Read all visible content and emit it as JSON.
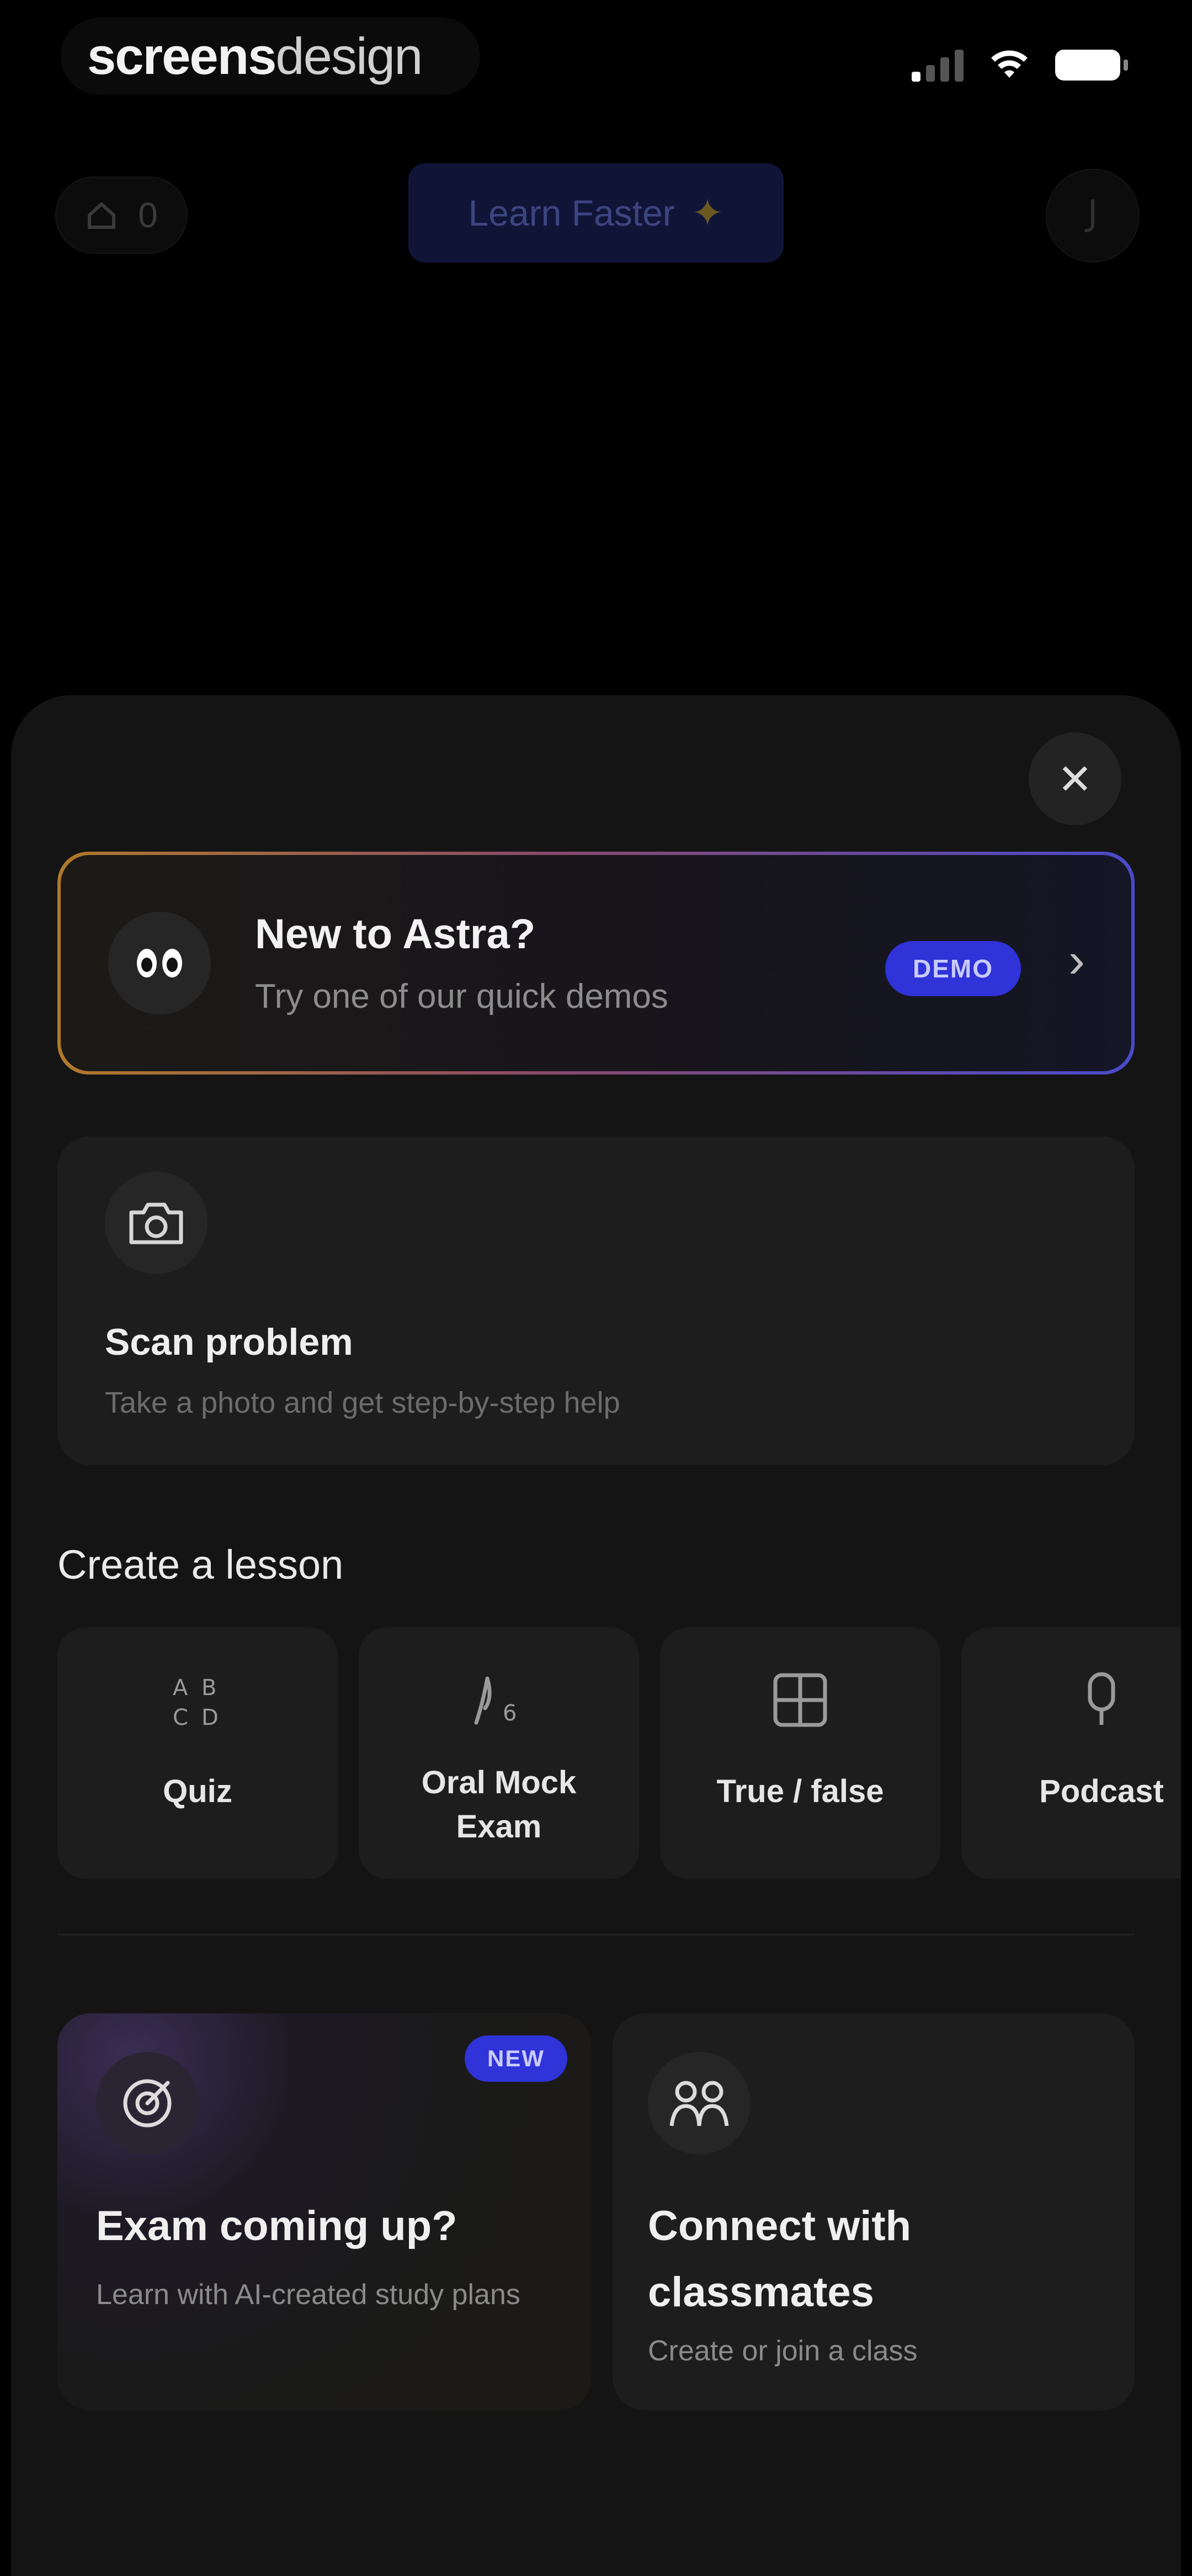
{
  "status_bar": {
    "brand_bold": "screens",
    "brand_light": "design"
  },
  "background": {
    "streak_count": "0",
    "learn_button": "Learn Faster",
    "learn_spark": "✦"
  },
  "sheet": {
    "close_glyph": "✕",
    "demo": {
      "title": "New to Astra?",
      "subtitle": "Try one of our quick demos",
      "badge": "DEMO",
      "chevron": "›"
    },
    "scan": {
      "title": "Scan problem",
      "subtitle": "Take a photo and get step-by-step help"
    },
    "create_lesson": {
      "heading": "Create a lesson",
      "items": [
        {
          "label": "Quiz",
          "icon": "quiz-icon"
        },
        {
          "label": "Oral Mock Exam",
          "icon": "oral-exam-icon"
        },
        {
          "label": "True / false",
          "icon": "true-false-icon"
        },
        {
          "label": "Podcast",
          "icon": "podcast-icon"
        }
      ]
    },
    "exam": {
      "badge": "NEW",
      "title": "Exam coming up?",
      "subtitle": "Learn with AI-created study plans"
    },
    "classmates": {
      "title": "Connect with classmates",
      "subtitle": "Create or join a class"
    }
  },
  "colors": {
    "accent": "#2f33d8",
    "sheet_bg": "#141414",
    "card_bg": "#1d1d1d"
  }
}
